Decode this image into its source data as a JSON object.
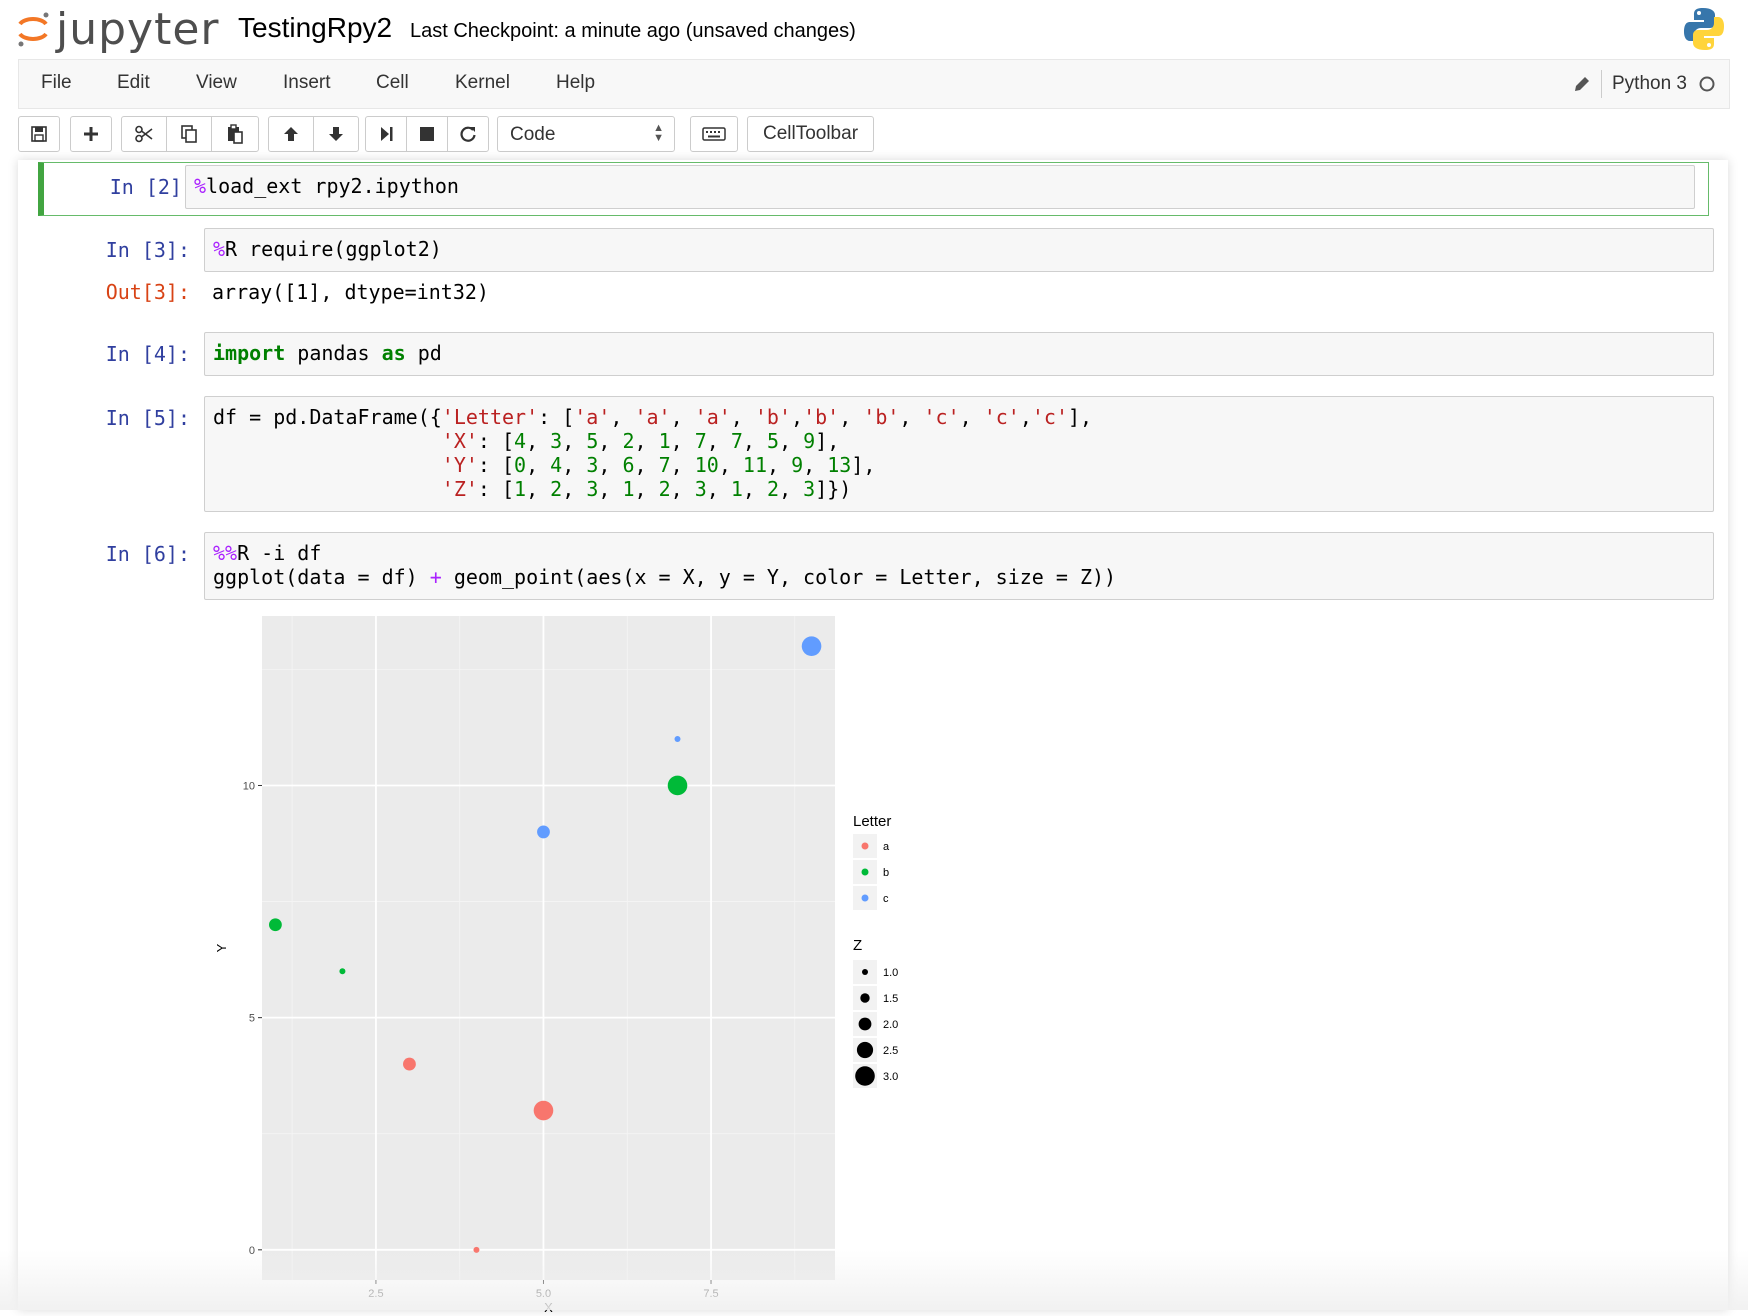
{
  "header": {
    "logo_text": "jupyter",
    "notebook_title": "TestingRpy2",
    "checkpoint": "Last Checkpoint: a minute ago (unsaved changes)"
  },
  "menu": {
    "items": [
      "File",
      "Edit",
      "View",
      "Insert",
      "Cell",
      "Kernel",
      "Help"
    ],
    "kernel_name": "Python 3"
  },
  "toolbar": {
    "cell_type": "Code",
    "celltoolbar_label": "CellToolbar",
    "buttons": [
      "save-icon",
      "plus-icon",
      "scissors-icon",
      "copy-icon",
      "paste-icon",
      "arrow-up-icon",
      "arrow-down-icon",
      "step-forward-icon",
      "stop-icon",
      "restart-icon",
      "keyboard-icon"
    ]
  },
  "cells": [
    {
      "prompt": "In [2]:",
      "code": "%load_ext rpy2.ipython"
    },
    {
      "prompt": "In [3]:",
      "code": "%R require(ggplot2)",
      "out_prompt": "Out[3]:",
      "output": "array([1], dtype=int32)"
    },
    {
      "prompt": "In [4]:",
      "code": "import pandas as pd"
    },
    {
      "prompt": "In [5]:",
      "code": "df = pd.DataFrame({'Letter': ['a', 'a', 'a', 'b','b', 'b', 'c', 'c','c'],\n                   'X': [4, 3, 5, 2, 1, 7, 7, 5, 9],\n                   'Y': [0, 4, 3, 6, 7, 10, 11, 9, 13],\n                   'Z': [1, 2, 3, 1, 2, 3, 1, 2, 3]})"
    },
    {
      "prompt": "In [6]:",
      "code": "%%R -i df\nggplot(data = df) + geom_point(aes(x = X, y = Y, color = Letter, size = Z))"
    }
  ],
  "chart_data": {
    "type": "scatter",
    "xlabel": "X",
    "ylabel": "Y",
    "xlim": [
      0.8,
      9.35
    ],
    "ylim": [
      -0.65,
      13.65
    ],
    "xticks": [
      2.5,
      5.0,
      7.5
    ],
    "xtick_labels": [
      "2.5",
      "5.0",
      "7.5"
    ],
    "yticks": [
      0,
      5,
      10
    ],
    "ytick_labels": [
      "0",
      "5",
      "10"
    ],
    "grid": true,
    "background": "#ebebeb",
    "points": [
      {
        "letter": "a",
        "x": 4,
        "y": 0,
        "z": 1
      },
      {
        "letter": "a",
        "x": 3,
        "y": 4,
        "z": 2
      },
      {
        "letter": "a",
        "x": 5,
        "y": 3,
        "z": 3
      },
      {
        "letter": "b",
        "x": 2,
        "y": 6,
        "z": 1
      },
      {
        "letter": "b",
        "x": 1,
        "y": 7,
        "z": 2
      },
      {
        "letter": "b",
        "x": 7,
        "y": 10,
        "z": 3
      },
      {
        "letter": "c",
        "x": 7,
        "y": 11,
        "z": 1
      },
      {
        "letter": "c",
        "x": 5,
        "y": 9,
        "z": 2
      },
      {
        "letter": "c",
        "x": 9,
        "y": 13,
        "z": 3
      }
    ],
    "colors": {
      "a": "#f8766d",
      "b": "#00ba38",
      "c": "#619cff"
    },
    "legend_color": {
      "title": "Letter",
      "entries": [
        "a",
        "b",
        "c"
      ]
    },
    "legend_size": {
      "title": "Z",
      "entries": [
        "1.0",
        "1.5",
        "2.0",
        "2.5",
        "3.0"
      ],
      "values": [
        1.0,
        1.5,
        2.0,
        2.5,
        3.0
      ]
    },
    "legend_position": "right"
  }
}
